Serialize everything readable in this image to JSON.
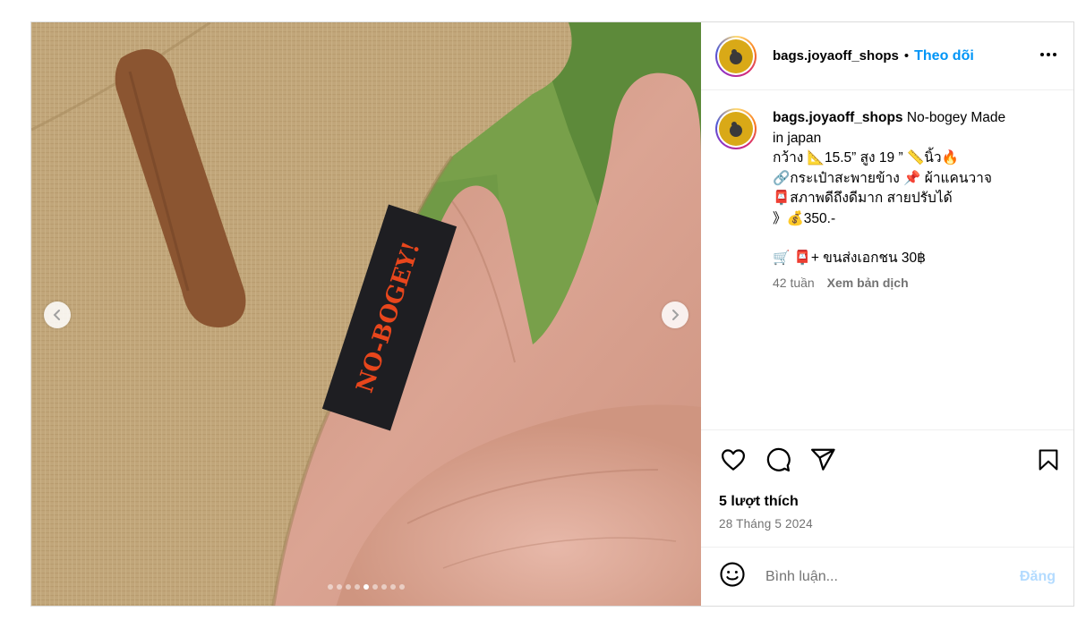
{
  "post": {
    "username": "bags.joyaoff_shops",
    "separator": "•",
    "follow_label": "Theo dõi",
    "more_icon": "more-horizontal-icon",
    "caption": {
      "username": "bags.joyaoff_shops",
      "lines": [
        "No-bogey Made",
        "in japan",
        "กว้าง 📐15.5” สูง 19 ” 📏นิ้ว🔥",
        "🔗กระเป๋าสะพายข้าง 📌 ผ้าแคนวาจ",
        "📮สภาพดีถึงดีมาก สายปรับได้",
        "》💰350.-",
        "🛒 📮+ ขนส่งเอกชน 30฿"
      ],
      "age": "42 tuần",
      "translate_label": "Xem bản dịch"
    },
    "product_label_text": "NO-BOGEY!",
    "carousel": {
      "count": 9,
      "active_index": 4
    },
    "likes": "5 lượt thích",
    "date": "28 Tháng 5 2024",
    "comment": {
      "placeholder": "Bình luận...",
      "post_label": "Đăng"
    }
  },
  "icons": {
    "like": "heart-icon",
    "comment": "comment-icon",
    "share": "share-icon",
    "save": "bookmark-icon",
    "emoji": "emoji-icon",
    "prev": "chevron-left-icon",
    "next": "chevron-right-icon"
  },
  "colors": {
    "accent": "#0095f6",
    "post_disabled": "#b3dbff",
    "meta": "#737373",
    "label_text": "#e8461c",
    "label_bg": "#1e1e22"
  }
}
